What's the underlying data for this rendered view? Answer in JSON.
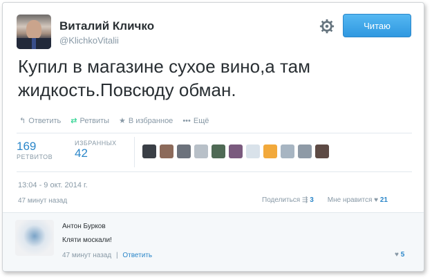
{
  "user": {
    "name": "Виталий Кличко",
    "handle": "@KlichkoVitalii"
  },
  "follow_button": "Читаю",
  "tweet": {
    "text_line1": "Купил в магазине сухое вино,а там",
    "text_line2": "жидкость.Повсюду обман."
  },
  "actions": {
    "reply": "Ответить",
    "retweet": "Ретвиты",
    "favorite": "В избранное",
    "more": "Ещё"
  },
  "stats": {
    "retweets_count": "169",
    "retweets_label": "РЕТВИТОВ",
    "favorites_label": "ИЗБРАННЫХ",
    "favorites_count": "42"
  },
  "timestamp": "13:04 - 9 окт. 2014 г.",
  "time_ago": "47 минут назад",
  "share": {
    "label": "Поделиться",
    "count": "3",
    "likes_label": "Мне нравится",
    "likes_count": "21"
  },
  "reply": {
    "name": "Антон Бурков",
    "text": "Кляти москали!",
    "time": "47 минут назад",
    "separator": "|",
    "reply_link": "Ответить",
    "likes_count": "5"
  },
  "colors": {
    "accent": "#2a86c9",
    "follow_bg": "#3aa3e8",
    "muted": "#8899a6"
  },
  "icons": {
    "gear": "gear-icon",
    "reply": "reply-icon",
    "retweet": "retweet-icon",
    "star": "star-icon",
    "heart": "heart-icon"
  }
}
